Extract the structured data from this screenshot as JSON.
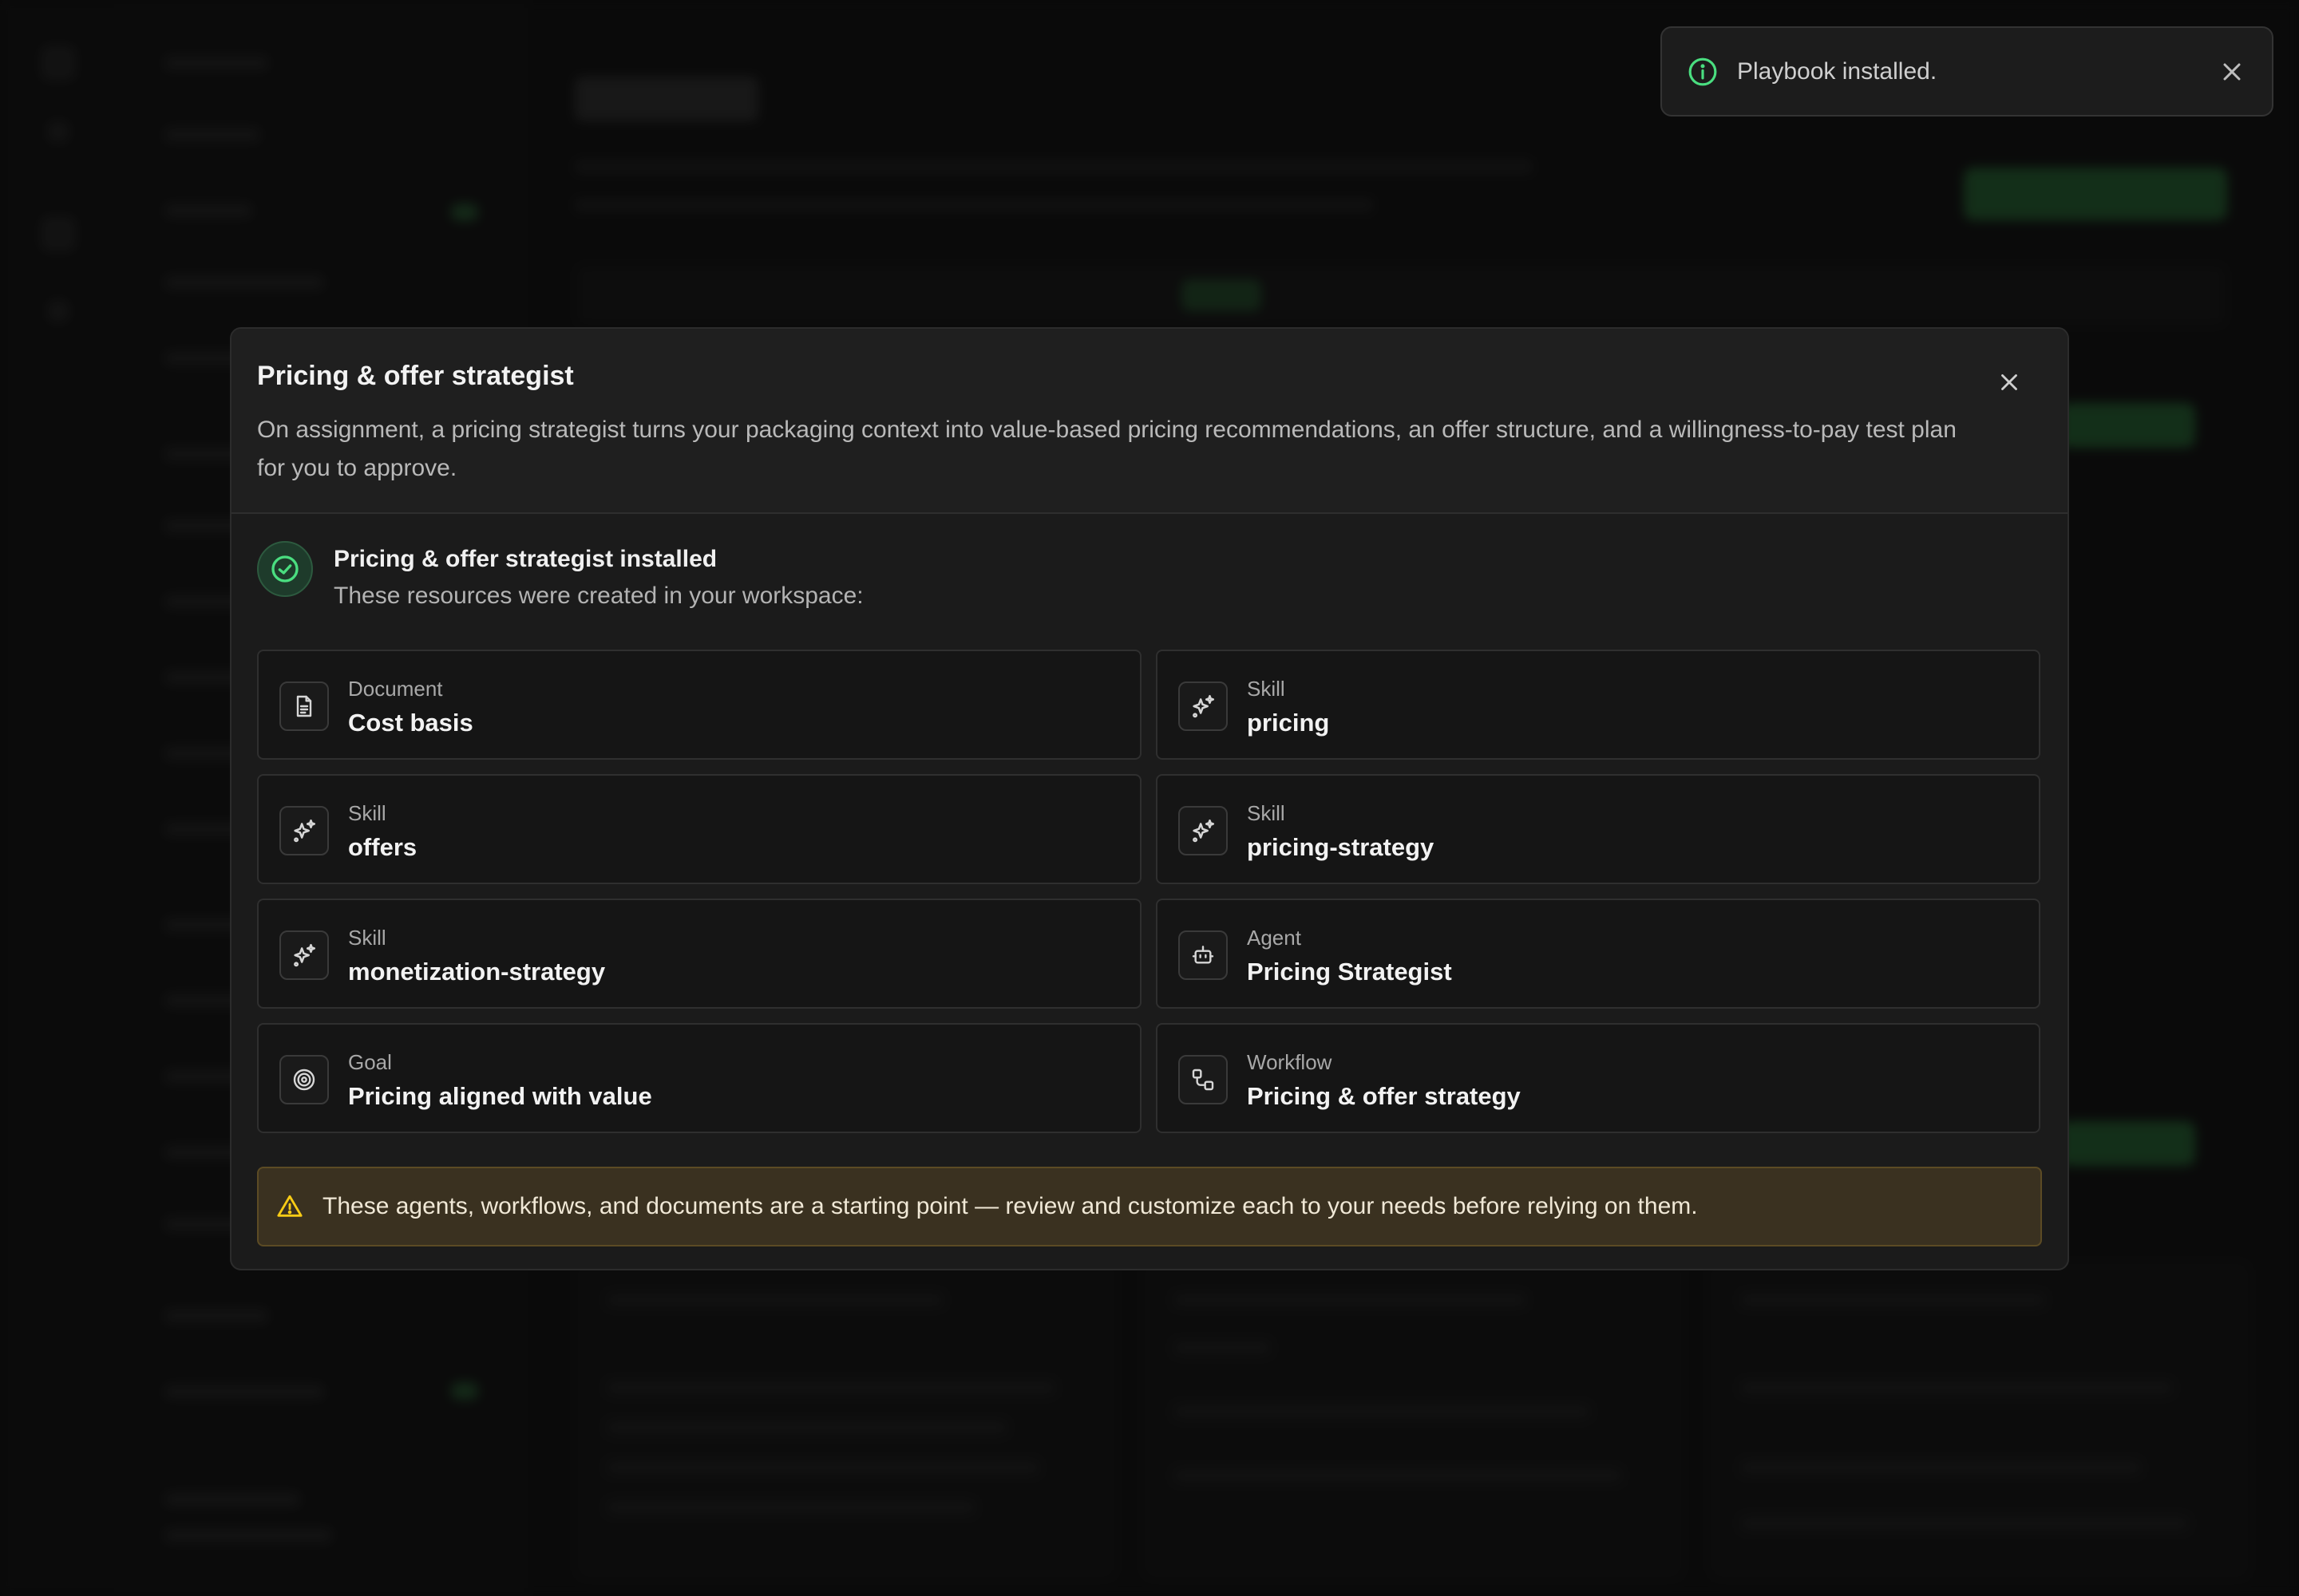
{
  "toast": {
    "message": "Playbook installed.",
    "icon": "info-icon",
    "accent": "#4ade80"
  },
  "modal": {
    "title": "Pricing & offer strategist",
    "description": "On assignment, a pricing strategist turns your packaging context into value-based pricing recommendations, an offer structure, and a willingness-to-pay test plan for you to approve.",
    "installed_title": "Pricing & offer strategist installed",
    "installed_subtitle": "These resources were created in your workspace:",
    "resources": [
      {
        "type": "Document",
        "name": "Cost basis",
        "icon": "document-icon"
      },
      {
        "type": "Skill",
        "name": "pricing",
        "icon": "sparkles-icon"
      },
      {
        "type": "Skill",
        "name": "offers",
        "icon": "sparkles-icon"
      },
      {
        "type": "Skill",
        "name": "pricing-strategy",
        "icon": "sparkles-icon"
      },
      {
        "type": "Skill",
        "name": "monetization-strategy",
        "icon": "sparkles-icon"
      },
      {
        "type": "Agent",
        "name": "Pricing Strategist",
        "icon": "robot-icon"
      },
      {
        "type": "Goal",
        "name": "Pricing aligned with value",
        "icon": "target-icon"
      },
      {
        "type": "Workflow",
        "name": "Pricing & offer strategy",
        "icon": "workflow-icon"
      }
    ],
    "warning": "These agents, workflows, and documents are a starting point — review and customize each to your needs before relying on them.",
    "warning_color": "#facc15",
    "success_color": "#4ade80"
  }
}
